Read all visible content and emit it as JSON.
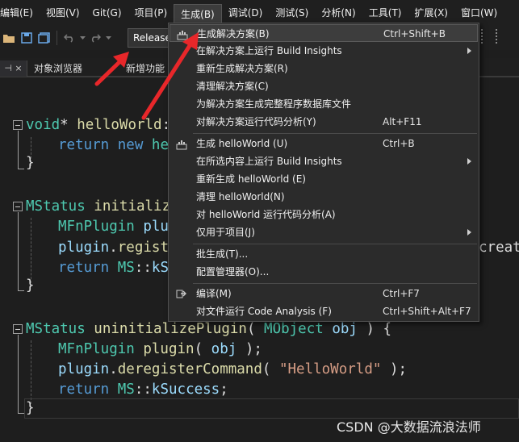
{
  "menubar": {
    "items": [
      {
        "label": "编辑(E)",
        "left": 0
      },
      {
        "label": "视图(V)"
      },
      {
        "label": "Git(G)"
      },
      {
        "label": "项目(P)"
      },
      {
        "label": "生成(B)",
        "active": true
      },
      {
        "label": "调试(D)"
      },
      {
        "label": "测试(S)"
      },
      {
        "label": "分析(N)"
      },
      {
        "label": "工具(T)"
      },
      {
        "label": "扩展(X)"
      },
      {
        "label": "窗口(W)"
      }
    ]
  },
  "toolbar": {
    "configuration": "Release"
  },
  "tabs": {
    "object_browser": "对象浏览器",
    "new_features": "新增功能"
  },
  "editor": {
    "lines": [
      {
        "parts": [
          [
            "ty",
            "void"
          ],
          [
            "plain",
            "* "
          ],
          [
            "fn",
            "helloWorld"
          ],
          [
            "plain",
            ":"
          ]
        ]
      },
      {
        "parts": [
          [
            "kw",
            "return "
          ],
          [
            "kw",
            "new "
          ],
          [
            "ty",
            "he"
          ]
        ]
      },
      {
        "parts": [
          [
            "ty",
            "MStatus "
          ],
          [
            "fn",
            "initializ"
          ]
        ]
      },
      {
        "parts": [
          [
            "ty",
            "MFnPlugin "
          ],
          [
            "pm",
            "plug"
          ]
        ]
      },
      {
        "parts": [
          [
            "pm",
            "plugin"
          ],
          [
            "plain",
            "."
          ],
          [
            "fn",
            "regist"
          ]
        ]
      },
      {
        "parts": [
          [
            "kw",
            "return "
          ],
          [
            "ty",
            "MS"
          ],
          [
            "plain",
            "::"
          ],
          [
            "pm",
            "kS"
          ]
        ]
      },
      {
        "parts": [
          [
            "plain",
            "creato"
          ]
        ]
      },
      {
        "parts": [
          [
            "ty",
            "MStatus "
          ],
          [
            "fn",
            "uninitializePlugin"
          ],
          [
            "plain",
            "( "
          ],
          [
            "ty",
            "MObject "
          ],
          [
            "pm",
            "obj "
          ],
          [
            "plain",
            ") {"
          ]
        ]
      },
      {
        "parts": [
          [
            "ty",
            "MFnPlugin "
          ],
          [
            "fn",
            "plugin"
          ],
          [
            "plain",
            "( "
          ],
          [
            "pm",
            "obj "
          ],
          [
            "plain",
            ");"
          ]
        ]
      },
      {
        "parts": [
          [
            "pm",
            "plugin"
          ],
          [
            "plain",
            "."
          ],
          [
            "fn",
            "deregisterCommand"
          ],
          [
            "plain",
            "( "
          ],
          [
            "st",
            "\"HelloWorld\" "
          ],
          [
            "plain",
            ");"
          ]
        ]
      },
      {
        "parts": [
          [
            "kw",
            "return "
          ],
          [
            "ty",
            "MS"
          ],
          [
            "plain",
            "::"
          ],
          [
            "pm",
            "kSuccess"
          ],
          [
            "plain",
            ";"
          ]
        ]
      }
    ]
  },
  "build_menu": {
    "items": [
      {
        "label": "生成解决方案(B)",
        "shortcut": "Ctrl+Shift+B",
        "icon": "build-solution-icon",
        "highlighted": true
      },
      {
        "label": "在解决方案上运行 Build Insights",
        "submenu": true
      },
      {
        "label": "重新生成解决方案(R)"
      },
      {
        "label": "清理解决方案(C)"
      },
      {
        "label": "为解决方案生成完整程序数据库文件"
      },
      {
        "label": "对解决方案运行代码分析(Y)",
        "shortcut": "Alt+F11"
      },
      {
        "separator": true
      },
      {
        "label": "生成 helloWorld (U)",
        "shortcut": "Ctrl+B",
        "icon": "build-project-icon"
      },
      {
        "label": "在所选内容上运行 Build Insights",
        "submenu": true
      },
      {
        "label": "重新生成 helloWorld (E)"
      },
      {
        "label": "清理 helloWorld(N)"
      },
      {
        "label": "对 helloWorld 运行代码分析(A)"
      },
      {
        "label": "仅用于项目(J)",
        "submenu": true
      },
      {
        "separator": true
      },
      {
        "label": "批生成(T)..."
      },
      {
        "label": "配置管理器(O)..."
      },
      {
        "separator": true
      },
      {
        "label": "编译(M)",
        "shortcut": "Ctrl+F7",
        "icon": "compile-icon"
      },
      {
        "label": "对文件运行 Code Analysis (F)",
        "shortcut": "Ctrl+Shift+Alt+F7"
      }
    ]
  },
  "watermark": "CSDN @大数据流浪法师",
  "colors": {
    "background": "#1e1e1e",
    "annotation_arrow": "#e8272a",
    "keyword": "#569cd6",
    "type": "#4ec9b0",
    "function": "#dcdcaa",
    "parameter": "#9cdcfe",
    "string": "#d69d85"
  }
}
